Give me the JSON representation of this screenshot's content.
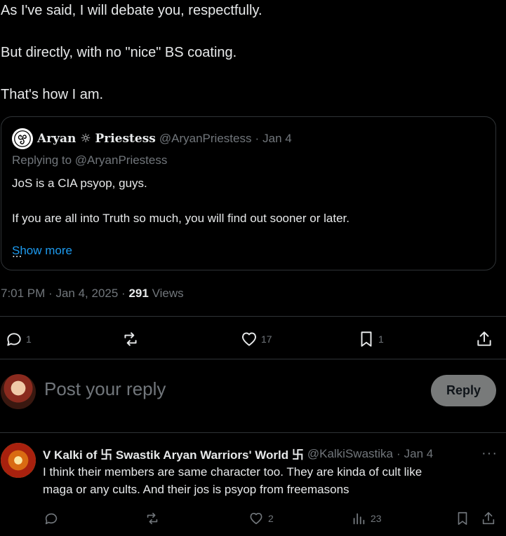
{
  "post": {
    "paragraphs": [
      "As I've said, I will debate you, respectfully.",
      "But directly, with no \"nice\" BS coating.",
      "That's how I am."
    ],
    "time": "7:01 PM",
    "date": "Jan 4, 2025",
    "views_count": "291",
    "views_label": "Views",
    "separator": "·"
  },
  "quote": {
    "name": "Aryan ☼ Priestess",
    "handle": "@AryanPriestess",
    "date": "Jan 4",
    "replying_to": "Replying to @AryanPriestess",
    "paragraphs": [
      "JoS is a CIA psyop, guys.",
      "If you are all into Truth so much, you will find out sooner or later."
    ],
    "ellipsis": "...",
    "show_more": "Show more"
  },
  "actions": {
    "replies": "1",
    "reposts": "",
    "likes": "17",
    "bookmarks": "1"
  },
  "compose": {
    "placeholder": "Post your reply",
    "button": "Reply"
  },
  "comment": {
    "name": "V Kalki of 卐 Swastik Aryan Warriors' World 卐",
    "handle": "@KalkiSwastika",
    "date": "Jan 4",
    "more": "···",
    "lines": [
      "I think their members are same character too. They are kinda of cult like",
      "maga or any cults. And their jos is psyop from freemasons"
    ],
    "replies": "",
    "reposts": "",
    "likes": "2",
    "views": "23"
  },
  "colors": {
    "background": "#000000",
    "text": "#e7e9ea",
    "muted": "#71767b",
    "link": "#1d9bf0",
    "border": "#2f3336"
  }
}
